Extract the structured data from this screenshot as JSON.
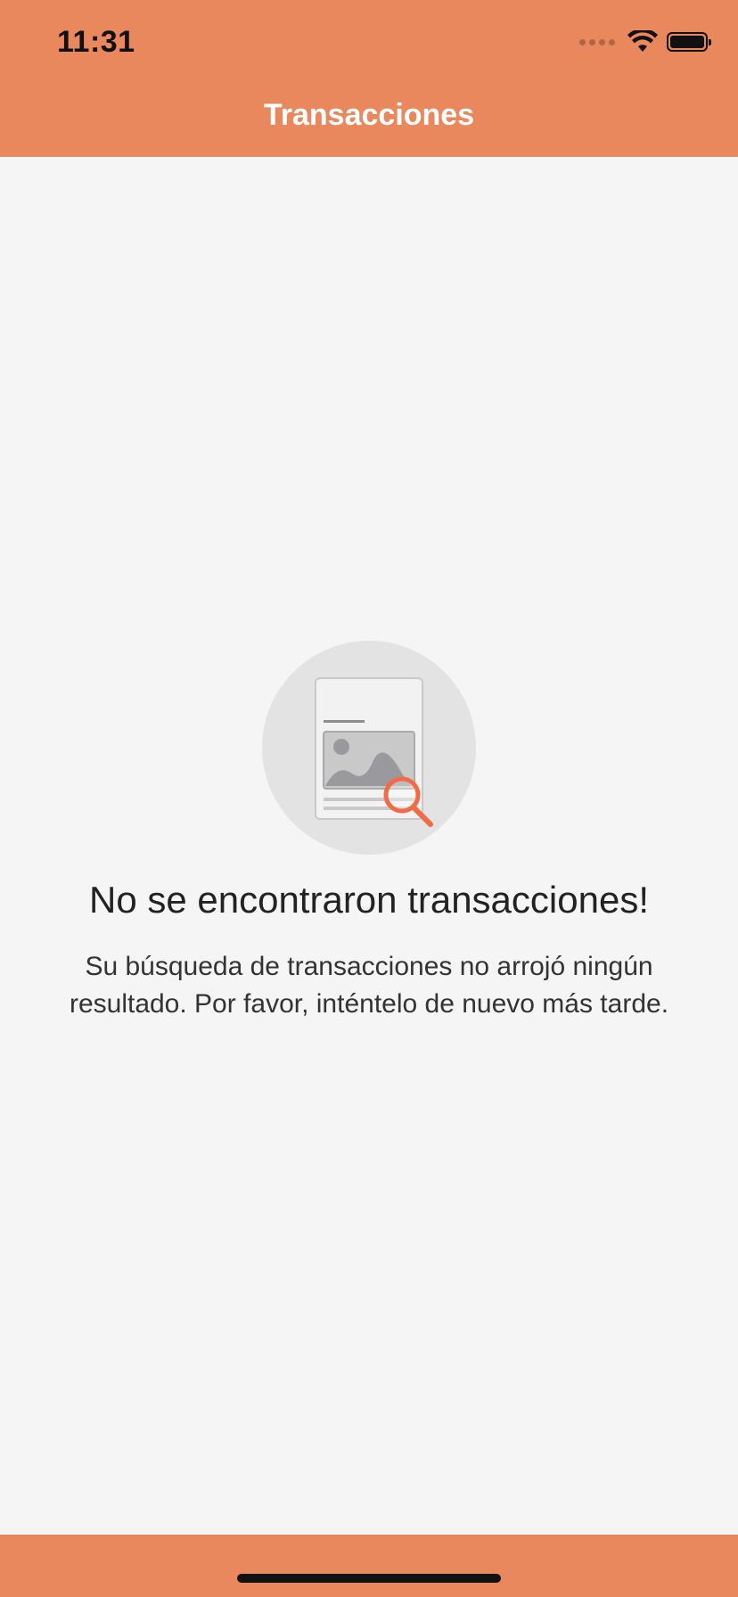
{
  "status_bar": {
    "time": "11:31",
    "icons": [
      "signal-icon",
      "wifi-icon",
      "battery-icon"
    ]
  },
  "nav": {
    "title": "Transacciones"
  },
  "empty_state": {
    "icon": "document-search-icon",
    "title": "No se encontraron transacciones!",
    "message": "Su búsqueda de transacciones no arrojó ningún resultado. Por favor, inténtelo de nuevo más tarde."
  },
  "colors": {
    "accent": "#e8885c",
    "background": "#f5f5f5",
    "search_highlight": "#f26b45"
  }
}
